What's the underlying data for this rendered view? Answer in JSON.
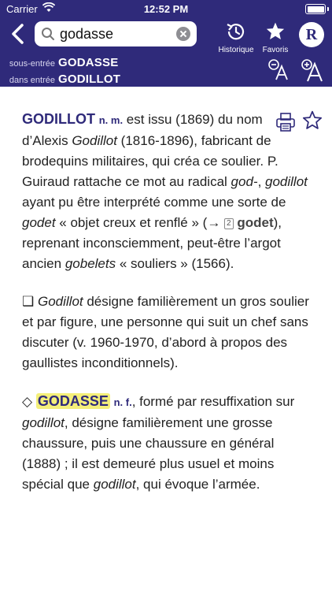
{
  "status": {
    "carrier": "Carrier",
    "time": "12:52 PM"
  },
  "search": {
    "value": "godasse",
    "placeholder": ""
  },
  "nav": {
    "historique": "Historique",
    "favoris": "Favoris",
    "logo": "R"
  },
  "entries": {
    "sub_label": "sous-entrée",
    "sub_value": "GODASSE",
    "in_label": "dans entrée",
    "in_value": "GODILLOT"
  },
  "article": {
    "p1": {
      "headword": "GODILLOT",
      "gram": "n. m.",
      "t1": " est issu (1869) du nom d’Alexis ",
      "i1": "Godillot",
      "t2": " (1816-1896), fabricant de brodequins militaires, qui créa ce soulier. P. Guiraud rattache ce mot au radical ",
      "i2": "god-",
      "t3": ", ",
      "i3": "godillot",
      "t4": " ayant pu être interprété comme une sorte de ",
      "i4": "godet",
      "t5": " « objet creux et renflé » (→ ",
      "refnum": "2",
      "ref": "godet",
      "t6": "), reprenant inconsciemment, peut-être l’argot ancien ",
      "i5": "gobelets",
      "t7": " « souliers » (1566)."
    },
    "p2": {
      "bullet": "❑",
      "i1": "Godillot",
      "t1": " désigne familièrement un gros soulier et par figure, une personne qui suit un chef sans discuter (v. 1960-1970, d’abord à propos des gaullistes inconditionnels)."
    },
    "p3": {
      "bullet": "◇",
      "headword": "GODASSE",
      "gram": "n. f.",
      "t1": ", formé par resuffixation sur ",
      "i1": "godillot",
      "t2": ", désigne familièrement une grosse chaussure, puis une chaussure en général (1888) ; il est demeuré plus usuel et moins spécial que ",
      "i2": "godillot",
      "t3": ", qui évoque l’armée."
    }
  }
}
